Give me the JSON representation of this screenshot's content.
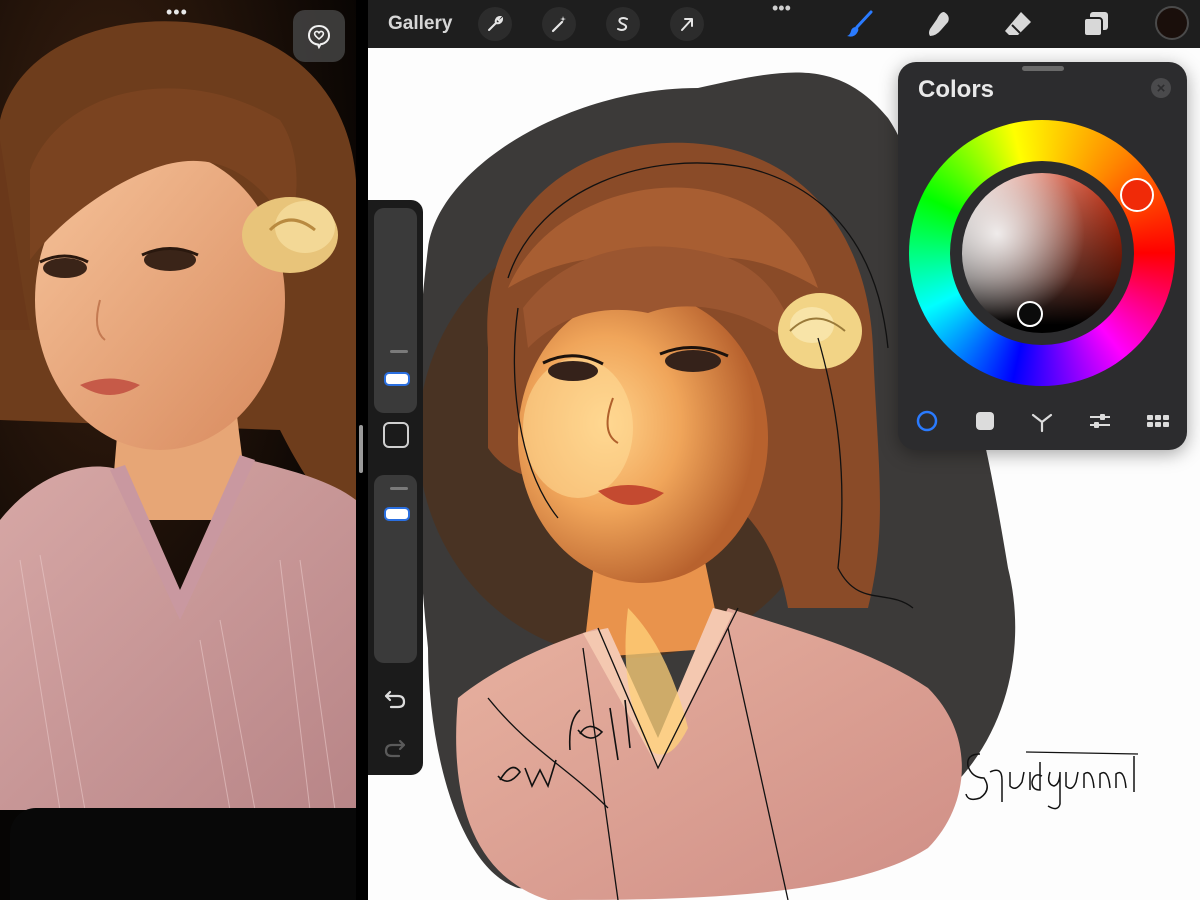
{
  "reference": {
    "heart_button": "heart-speech-icon",
    "menu_dots": "•••"
  },
  "toolbar": {
    "gallery_label": "Gallery",
    "menu_dots": "•••",
    "tools": [
      "wrench-icon",
      "magic-wand-icon",
      "selection-s-icon",
      "transform-arrow-icon"
    ],
    "painting_tools": [
      "brush-icon",
      "smudge-icon",
      "eraser-icon",
      "layers-icon"
    ],
    "active_color": "#1a0f0b",
    "active_tool": "brush",
    "accent": "#2a7bff"
  },
  "sidebar": {
    "brush_size_label": "brush-size-slider",
    "opacity_label": "opacity-slider",
    "undo": "undo-arrow-icon",
    "redo": "redo-arrow-icon"
  },
  "colors_panel": {
    "title": "Colors",
    "close": "×",
    "tabs": [
      "disc",
      "classic",
      "harmony",
      "value",
      "palettes"
    ],
    "active_tab": "disc",
    "hue_color": "#f02a08",
    "selected_color": "#0b0b0b"
  },
  "canvas": {
    "handwritten_note": "ew lol",
    "signature": "Squidgunnnl"
  }
}
